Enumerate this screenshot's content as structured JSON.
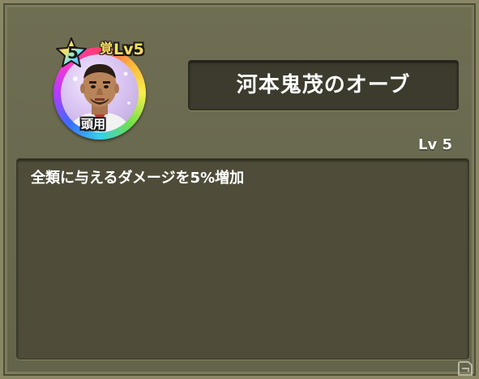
{
  "orb": {
    "name": "河本鬼茂のオーブ",
    "rarity_level": "5",
    "level_mark": "Lv5",
    "level_kanji": "覚",
    "slot": "頭用",
    "level_label": "Lv 5",
    "effect": "全類に与えるダメージを5%増加"
  },
  "colors": {
    "frame_bg": "#6a6a50",
    "plate_bg": "#3d3b2d",
    "desc_bg": "#4f4d39",
    "level_yellow": "#ffe05a"
  },
  "icons": {
    "orb": "character-orb-icon",
    "star": "rainbow-star-icon",
    "watermark": "site-logo-icon"
  }
}
